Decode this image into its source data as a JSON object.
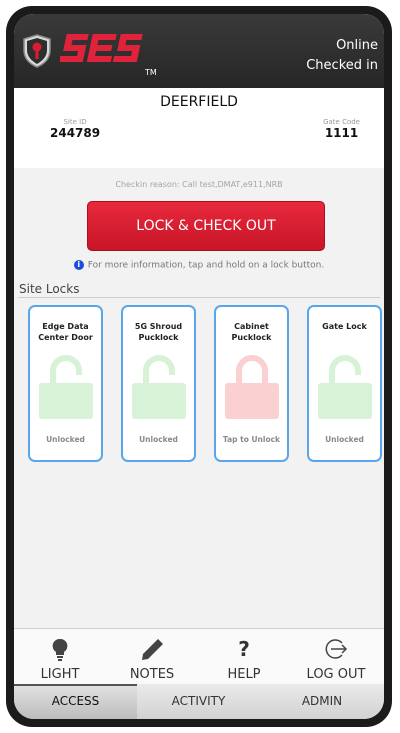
{
  "header": {
    "brand_text": "SES",
    "trademark": "TM",
    "status_line1": "Online",
    "status_line2": "Checked in"
  },
  "site": {
    "name": "DEERFIELD",
    "site_id_label": "Site ID",
    "site_id_value": "244789",
    "gate_code_label": "Gate Code",
    "gate_code_value": "1111"
  },
  "checkin_reason": "Checkin reason:  Call test,DMAT,e911,NRB",
  "lock_button_label": "LOCK & CHECK OUT",
  "info_text": "For more information, tap and hold on a lock button.",
  "site_locks_title": "Site Locks",
  "locks": [
    {
      "title_line1": "Edge Data",
      "title_line2": "Center Door",
      "status": "Unlocked",
      "state": "unlocked",
      "icon": "open-padlock-icon",
      "color": "#d8f2d8"
    },
    {
      "title_line1": "5G Shroud",
      "title_line2": "Pucklock",
      "status": "Unlocked",
      "state": "unlocked",
      "icon": "open-padlock-icon",
      "color": "#d8f2d8"
    },
    {
      "title_line1": "Cabinet",
      "title_line2": "Pucklock",
      "status": "Tap to Unlock",
      "state": "locked",
      "icon": "closed-padlock-icon",
      "color": "#fbd0d0"
    },
    {
      "title_line1": "Gate Lock",
      "title_line2": "",
      "status": "Unlocked",
      "state": "unlocked",
      "icon": "open-padlock-icon",
      "color": "#d8f2d8"
    }
  ],
  "toolbar": {
    "light_label": "LIGHT",
    "notes_label": "NOTES",
    "help_label": "HELP",
    "help_glyph": "?",
    "logout_label": "LOG OUT"
  },
  "tabs": {
    "access": "ACCESS",
    "activity": "ACTIVITY",
    "admin": "ADMIN",
    "active": "access"
  },
  "colors": {
    "accent_red": "#d81e31",
    "card_border": "#5aa6ea",
    "info_blue": "#1a4fd6"
  }
}
